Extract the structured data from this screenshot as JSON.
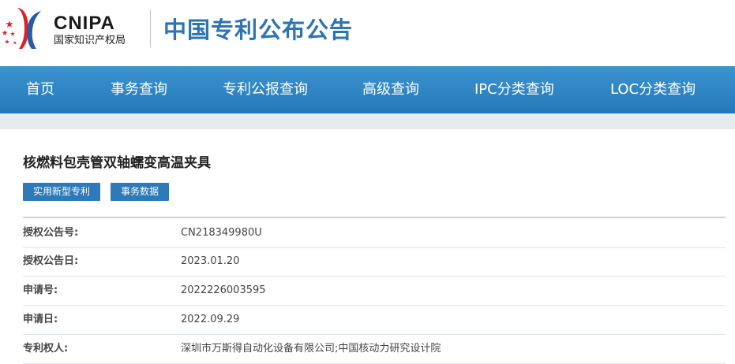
{
  "header": {
    "logo_abbr": "CNIPA",
    "logo_cn": "国家知识产权局",
    "site_title": "中国专利公布公告"
  },
  "nav": {
    "items": [
      {
        "label": "首页"
      },
      {
        "label": "事务查询"
      },
      {
        "label": "专利公报查询"
      },
      {
        "label": "高级查询"
      },
      {
        "label": "IPC分类查询"
      },
      {
        "label": "LOC分类查询"
      }
    ]
  },
  "patent": {
    "title": "核燃料包壳管双轴蠕变高温夹具",
    "tags": [
      {
        "label": "实用新型专利"
      },
      {
        "label": "事务数据"
      }
    ],
    "fields": [
      {
        "label": "授权公告号:",
        "value": "CN218349980U"
      },
      {
        "label": "授权公告日:",
        "value": "2023.01.20"
      },
      {
        "label": "申请号:",
        "value": "2022226003595"
      },
      {
        "label": "申请日:",
        "value": "2022.09.29"
      },
      {
        "label": "专利权人:",
        "value": "深圳市万斯得自动化设备有限公司;中国核动力研究设计院"
      }
    ]
  },
  "colors": {
    "nav_bg": "#2b80be",
    "title_blue": "#2d74b3",
    "tag_bg": "#2d7ab8",
    "logo_red": "#d9232e"
  }
}
